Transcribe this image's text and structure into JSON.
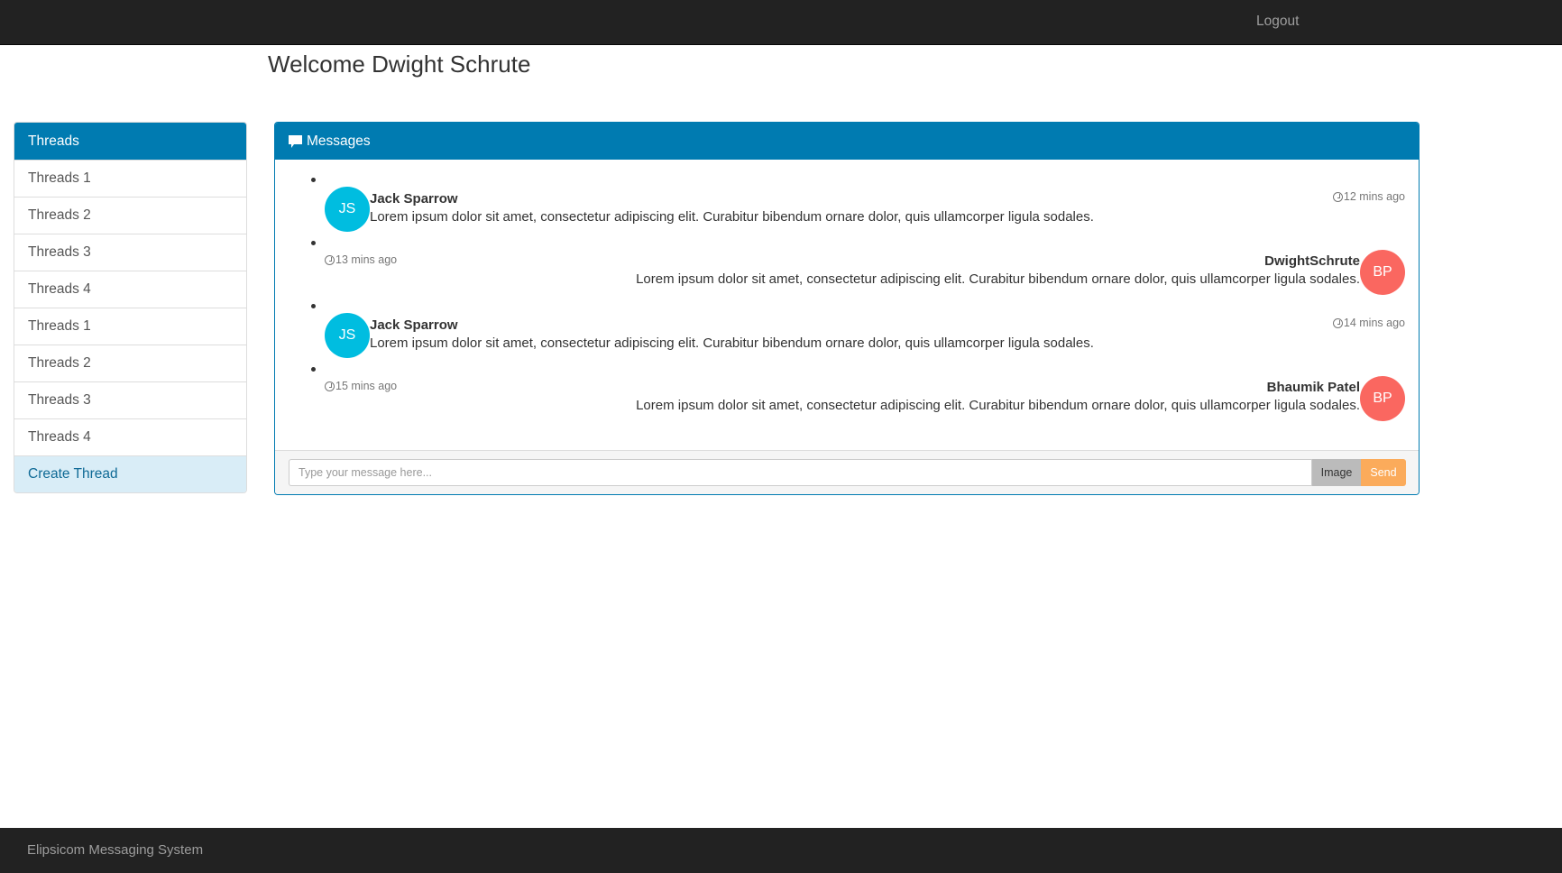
{
  "navbar": {
    "logout_label": "Logout"
  },
  "page_title": "Welcome Dwight Schrute",
  "sidebar": {
    "title": "Threads",
    "items": [
      {
        "label": "Threads 1"
      },
      {
        "label": "Threads 2"
      },
      {
        "label": "Threads 3"
      },
      {
        "label": "Threads 4"
      },
      {
        "label": "Threads 1"
      },
      {
        "label": "Threads 2"
      },
      {
        "label": "Threads 3"
      },
      {
        "label": "Threads 4"
      }
    ],
    "create_label": "Create Thread"
  },
  "messages": {
    "title": "Messages",
    "items": [
      {
        "side": "left",
        "initials": "JS",
        "name": "Jack Sparrow",
        "text": "Lorem ipsum dolor sit amet, consectetur adipiscing elit. Curabitur bibendum ornare dolor, quis ullamcorper ligula sodales.",
        "time": "12 mins ago"
      },
      {
        "side": "right",
        "initials": "BP",
        "name": "DwightSchrute",
        "text": "Lorem ipsum dolor sit amet, consectetur adipiscing elit. Curabitur bibendum ornare dolor, quis ullamcorper ligula sodales.",
        "time": "13 mins ago"
      },
      {
        "side": "left",
        "initials": "JS",
        "name": "Jack Sparrow",
        "text": "Lorem ipsum dolor sit amet, consectetur adipiscing elit. Curabitur bibendum ornare dolor, quis ullamcorper ligula sodales.",
        "time": "14 mins ago"
      },
      {
        "side": "right",
        "initials": "BP",
        "name": "Bhaumik Patel",
        "text": "Lorem ipsum dolor sit amet, consectetur adipiscing elit. Curabitur bibendum ornare dolor, quis ullamcorper ligula sodales.",
        "time": "15 mins ago"
      }
    ],
    "input_placeholder": "Type your message here...",
    "image_label": "Image",
    "send_label": "Send"
  },
  "footer": {
    "text": "Elipsicom Messaging System"
  }
}
